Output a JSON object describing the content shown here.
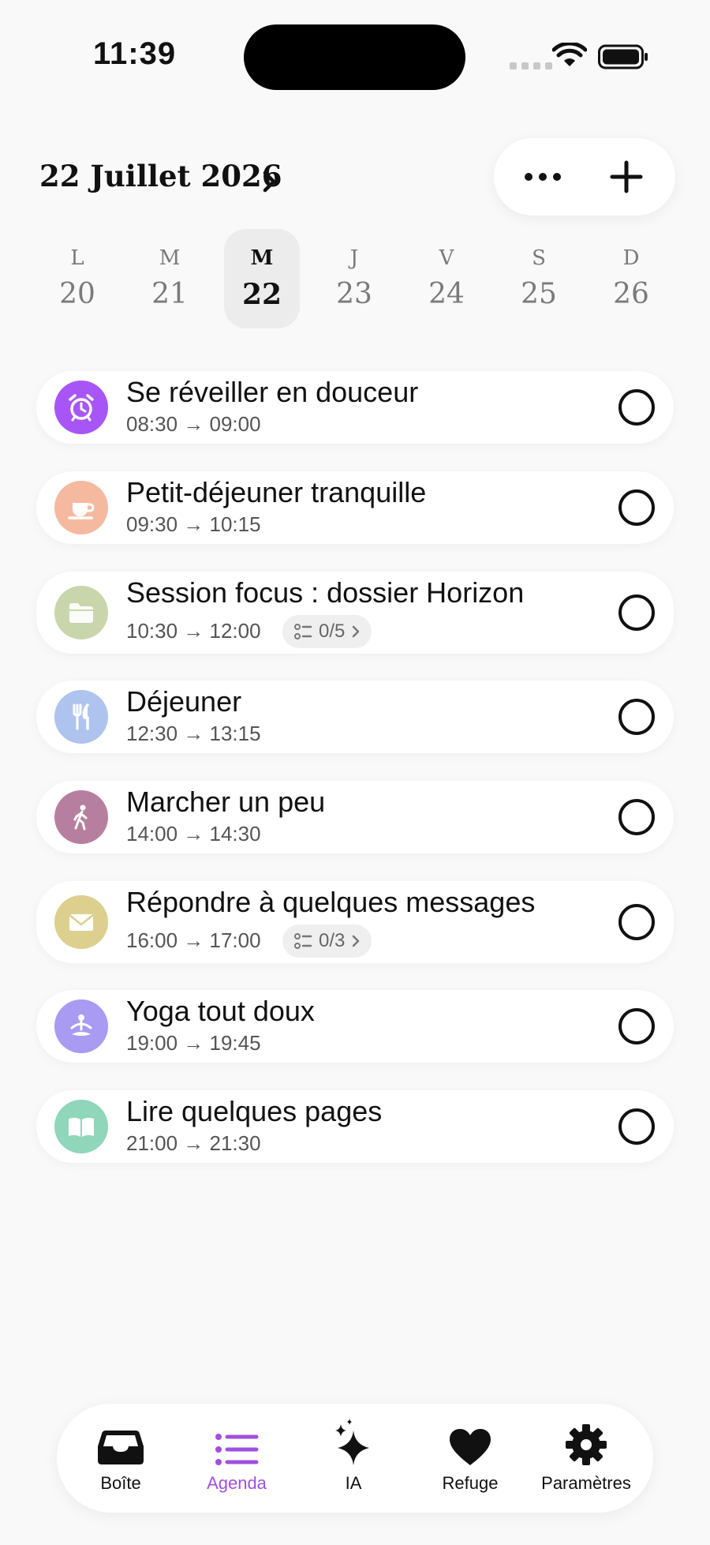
{
  "status_bar": {
    "time": "11:39"
  },
  "header": {
    "date_title": "22 Juillet 2026"
  },
  "week": {
    "days": [
      {
        "letter": "L",
        "number": "20",
        "selected": false
      },
      {
        "letter": "M",
        "number": "21",
        "selected": false
      },
      {
        "letter": "M",
        "number": "22",
        "selected": true
      },
      {
        "letter": "J",
        "number": "23",
        "selected": false
      },
      {
        "letter": "V",
        "number": "24",
        "selected": false
      },
      {
        "letter": "S",
        "number": "25",
        "selected": false
      },
      {
        "letter": "D",
        "number": "26",
        "selected": false
      }
    ]
  },
  "tasks": [
    {
      "title": "Se réveiller en douceur",
      "time": "08:30 → 09:00",
      "icon": "alarm-clock-icon",
      "color": "#a855f7"
    },
    {
      "title": "Petit-déjeuner tranquille",
      "time": "09:30 → 10:15",
      "icon": "coffee-cup-icon",
      "color": "#f5b9a0"
    },
    {
      "title": "Session focus : dossier Horizon",
      "time": "10:30 → 12:00",
      "icon": "folder-icon",
      "color": "#c9d6ac",
      "subtasks": "0/5"
    },
    {
      "title": "Déjeuner",
      "time": "12:30 → 13:15",
      "icon": "fork-knife-icon",
      "color": "#aec4ee"
    },
    {
      "title": "Marcher un peu",
      "time": "14:00 → 14:30",
      "icon": "walking-icon",
      "color": "#b77f9f"
    },
    {
      "title": "Répondre à quelques messages",
      "time": "16:00 → 17:00",
      "icon": "envelope-icon",
      "color": "#ddcf8e",
      "subtasks": "0/3"
    },
    {
      "title": "Yoga tout doux",
      "time": "19:00 → 19:45",
      "icon": "meditation-icon",
      "color": "#a99af2"
    },
    {
      "title": "Lire quelques pages",
      "time": "21:00 → 21:30",
      "icon": "open-book-icon",
      "color": "#8fd6ba"
    }
  ],
  "tabs": [
    {
      "label": "Boîte",
      "icon": "inbox-tray-icon",
      "active": false
    },
    {
      "label": "Agenda",
      "icon": "list-icon",
      "active": true
    },
    {
      "label": "IA",
      "icon": "sparkles-icon",
      "active": false
    },
    {
      "label": "Refuge",
      "icon": "heart-icon",
      "active": false
    },
    {
      "label": "Paramètres",
      "icon": "gear-icon",
      "active": false
    }
  ],
  "colors": {
    "accent": "#a050e0",
    "background": "#f9f9f9"
  }
}
